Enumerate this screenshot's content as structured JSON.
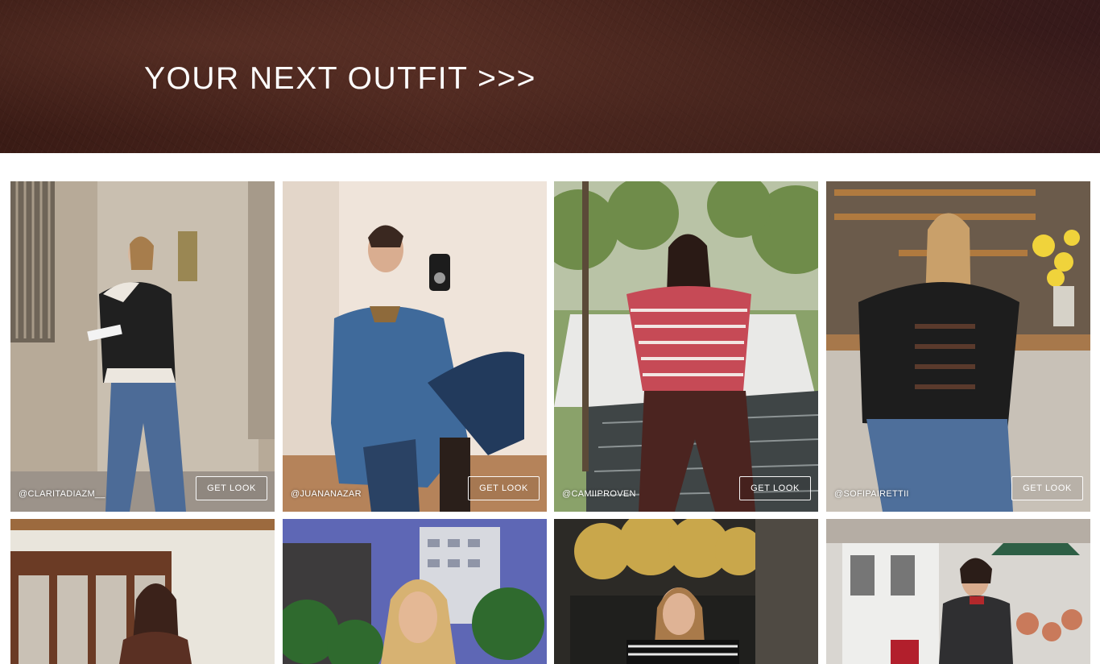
{
  "hero": {
    "title": "YOUR NEXT OUTFIT >>>"
  },
  "gallery": {
    "row1": [
      {
        "handle": "@CLARITADIAZM__",
        "button": "GET LOOK"
      },
      {
        "handle": "@JUANANAZAR",
        "button": "GET LOOK"
      },
      {
        "handle": "@CAMIIPROVEN",
        "button": "GET LOOK"
      },
      {
        "handle": "@SOFIPAIRETTII",
        "button": "GET LOOK"
      }
    ]
  },
  "colors": {
    "hero_background": "#3f1f19",
    "hero_text": "#ffffff",
    "button_border": "#ffffff"
  }
}
